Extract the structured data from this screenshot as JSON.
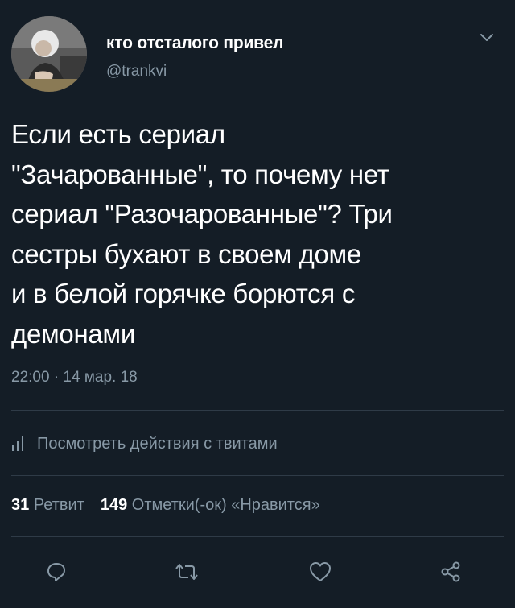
{
  "author": {
    "display_name": "кто отсталого привел",
    "handle": "@trankvi"
  },
  "tweet": {
    "lines": [
      "Если есть сериал",
      "\"Зачарованные\", то почему нет",
      "сериал \"Разочарованные\"? Три",
      "сестры бухают в своем доме",
      "и в белой горячке борются с",
      "демонами"
    ],
    "timestamp": "22:00 · 14 мар. 18"
  },
  "activity": {
    "label": "Посмотреть действия с твитами"
  },
  "stats": {
    "retweets_count": "31",
    "retweets_label": "Ретвит",
    "likes_count": "149",
    "likes_label": "Отметки(-ок) «Нравится»"
  },
  "icons": {
    "menu": "chevron-down-icon",
    "activity": "bar-chart-icon",
    "reply": "reply-icon",
    "retweet": "retweet-icon",
    "like": "heart-icon",
    "share": "share-icon"
  },
  "colors": {
    "background": "#141d26",
    "secondary_text": "#8899a6",
    "divider": "#2f3b47"
  }
}
